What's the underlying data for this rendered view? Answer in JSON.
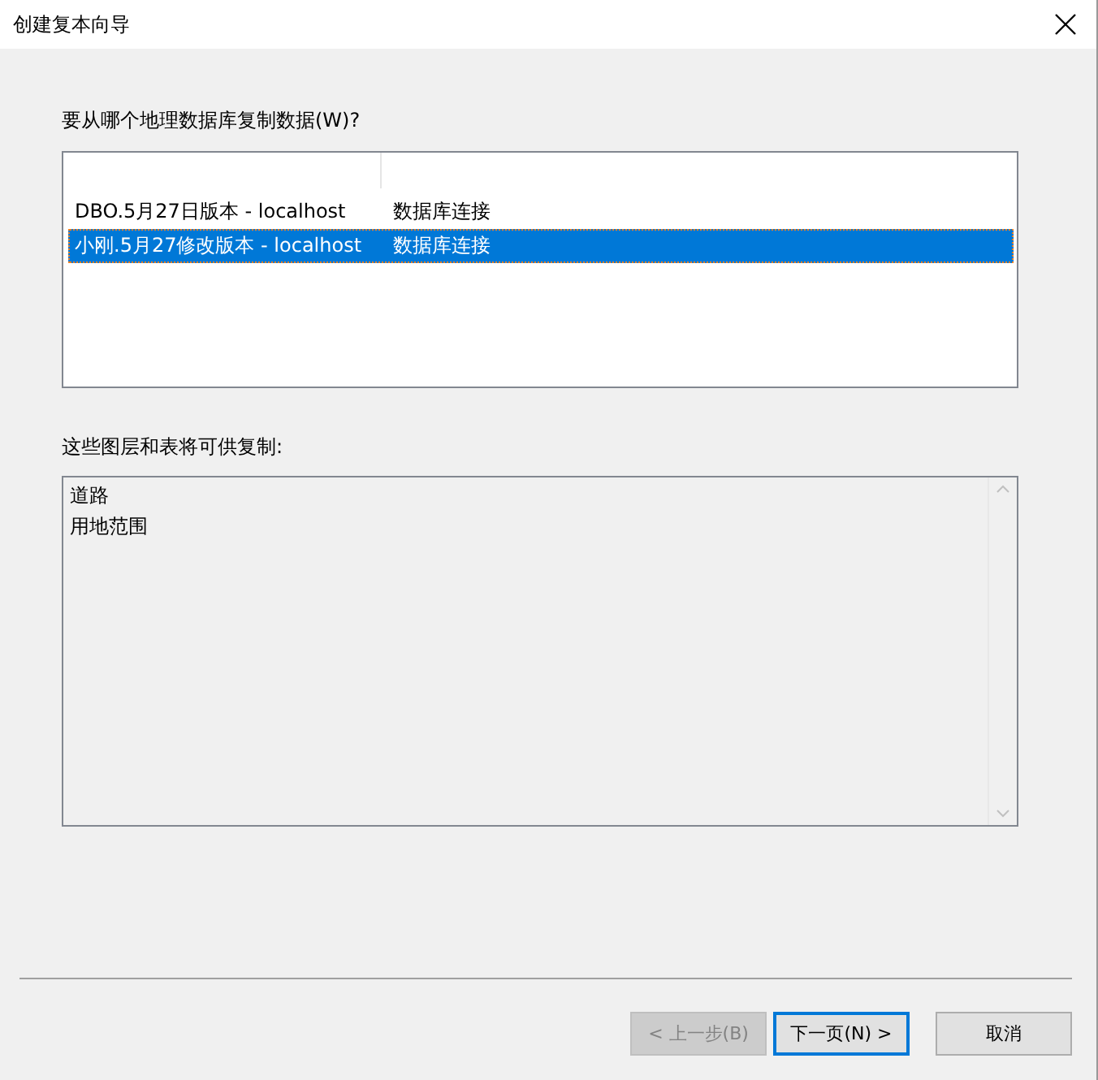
{
  "window": {
    "title": "创建复本向导"
  },
  "source_prompt": "要从哪个地理数据库复制数据(W)?",
  "source_list": {
    "rows": [
      {
        "name": "DBO.5月27日版本 - localhost",
        "type": "数据库连接",
        "selected": false
      },
      {
        "name": "小刚.5月27修改版本 - localhost",
        "type": "数据库连接",
        "selected": true
      }
    ]
  },
  "layers_label": "这些图层和表将可供复制:",
  "layers": [
    "道路",
    "用地范围"
  ],
  "buttons": [
    {
      "label": "< 上一步(B)",
      "disabled": true,
      "default": false
    },
    {
      "label": "下一页(N) >",
      "disabled": false,
      "default": true
    },
    {
      "label": "取消",
      "disabled": false,
      "default": false
    }
  ]
}
